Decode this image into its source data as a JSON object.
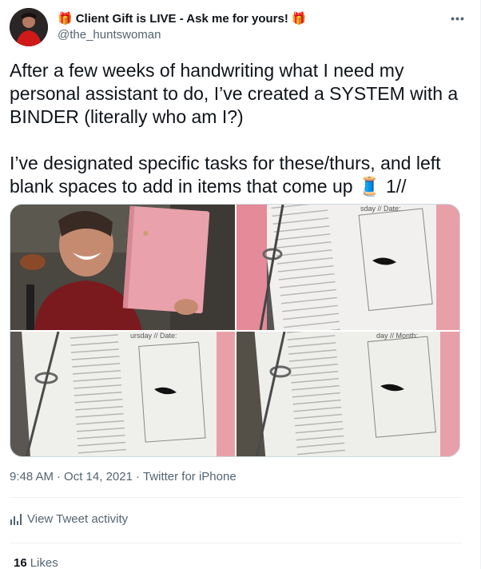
{
  "tweet": {
    "display_name": "Client Gift is LIVE - Ask me for yours!",
    "handle": "@the_huntswoman",
    "more_label": "•••",
    "text_line_1": "After a few weeks of handwriting what I need my personal assistant to do, I’ve created a SYSTEM with a BINDER (literally who am I?)",
    "text_line_2": "I’ve designated specific tasks for these/thurs, and left blank spaces to add in items that come up 🧵 1//",
    "time": "9:48 AM",
    "date": "Oct 14, 2021",
    "source": "Twitter for iPhone",
    "activity_label": "View Tweet activity",
    "likes_count": "16",
    "likes_label": "Likes"
  },
  "media": {
    "photo_1_caption": "Woman smiling holding a pink binder",
    "photo_2_caption": "Binder page: Wednesday // Date",
    "photo_3_caption": "Binder page: Thursday // Date",
    "photo_4_caption": "Binder page: Wednesday checklist",
    "page_header_2": "sday // Date:",
    "page_header_3": "ursday // Date:",
    "page_header_4": "day // Month:"
  },
  "colors": {
    "accent": "#1d9bf0",
    "text_primary": "#0f1419",
    "text_secondary": "#536471",
    "binder_pink": "#e8a0a8"
  }
}
